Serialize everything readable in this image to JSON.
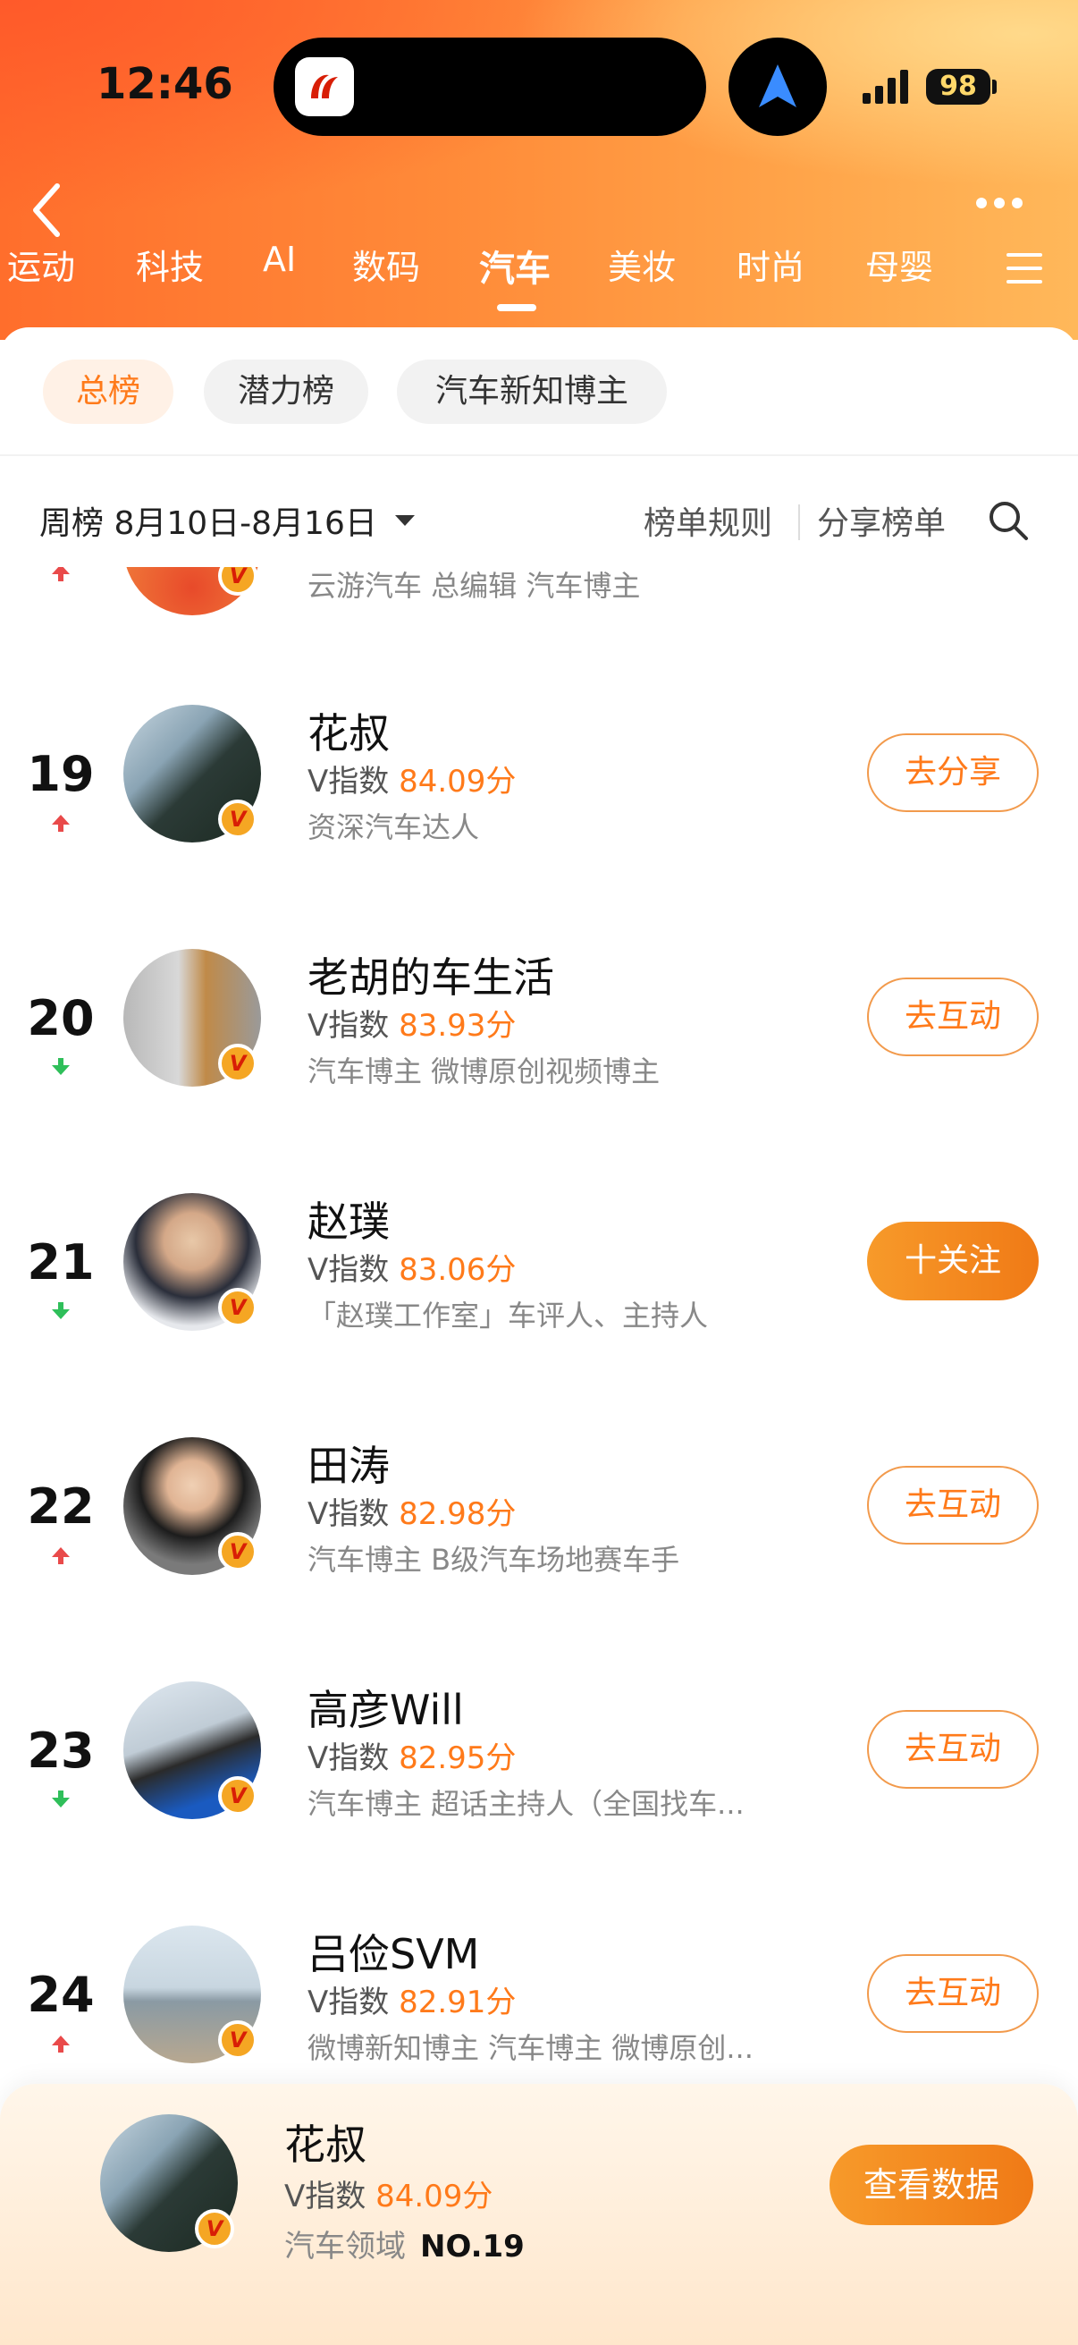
{
  "status_bar": {
    "time": "12:46",
    "battery": "98"
  },
  "category_tabs": [
    {
      "label": "运动",
      "active": false
    },
    {
      "label": "科技",
      "active": false
    },
    {
      "label": "AI",
      "active": false
    },
    {
      "label": "数码",
      "active": false
    },
    {
      "label": "汽车",
      "active": true
    },
    {
      "label": "美妆",
      "active": false
    },
    {
      "label": "时尚",
      "active": false
    },
    {
      "label": "母婴",
      "active": false
    }
  ],
  "chips": [
    {
      "label": "总榜",
      "active": true
    },
    {
      "label": "潜力榜",
      "active": false
    },
    {
      "label": "汽车新知博主",
      "active": false
    }
  ],
  "filter": {
    "period": "周榜 8月10日-8月16日",
    "rules": "榜单规则",
    "share": "分享榜单"
  },
  "partial_row": {
    "desc": "云游汽车 总编辑 汽车博主",
    "trend": "up"
  },
  "score_prefix": "V指数",
  "rows": [
    {
      "rank": "19",
      "trend": "up",
      "name": "花叔",
      "score": "84.09分",
      "desc": "资深汽车达人",
      "action": "去分享",
      "action_style": "outline"
    },
    {
      "rank": "20",
      "trend": "down",
      "name": "老胡的车生活",
      "score": "83.93分",
      "desc": "汽车博主 微博原创视频博主",
      "action": "去互动",
      "action_style": "outline"
    },
    {
      "rank": "21",
      "trend": "down",
      "name": "赵璞",
      "score": "83.06分",
      "desc": "「赵璞工作室」车评人、主持人",
      "action": "十关注",
      "action_style": "filled"
    },
    {
      "rank": "22",
      "trend": "up",
      "name": "田涛",
      "score": "82.98分",
      "desc": "汽车博主 B级汽车场地赛车手",
      "action": "去互动",
      "action_style": "outline"
    },
    {
      "rank": "23",
      "trend": "down",
      "name": "高彦Will",
      "score": "82.95分",
      "desc": "汽车博主 超话主持人（全国找车...",
      "action": "去互动",
      "action_style": "outline"
    },
    {
      "rank": "24",
      "trend": "up",
      "name": "吕俭SVM",
      "score": "82.91分",
      "desc": "微博新知博主 汽车博主 微博原创...",
      "action": "去互动",
      "action_style": "outline"
    }
  ],
  "me": {
    "name": "花叔",
    "score_prefix": "V指数",
    "score": "84.09分",
    "domain": "汽车领域",
    "rank": "NO.19",
    "button": "查看数据"
  },
  "colors": {
    "accent": "#ff7a1a",
    "trend_up": "#e94a4a",
    "trend_down": "#2fbf5a"
  }
}
